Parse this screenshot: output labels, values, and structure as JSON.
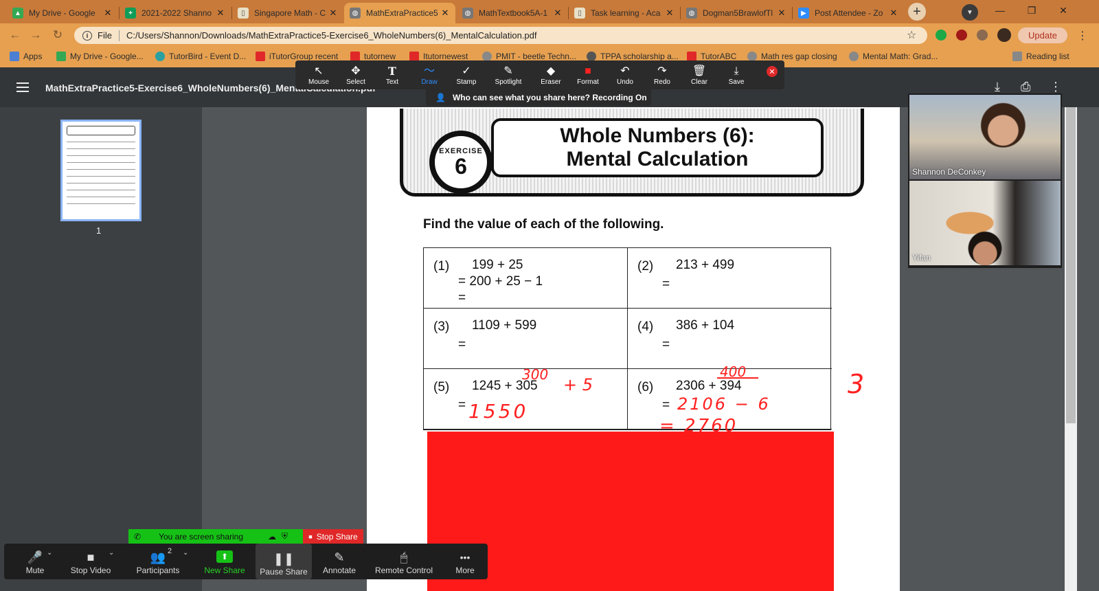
{
  "tabs": [
    {
      "title": "My Drive - Google",
      "icon": "google-drive-icon",
      "color": "#34a853",
      "active": false
    },
    {
      "title": "2021-2022 Shanno",
      "icon": "google-sheets-icon",
      "color": "#0f9d58",
      "active": false
    },
    {
      "title": "Singapore Math - C",
      "icon": "document-icon",
      "color": "#e8e0c8",
      "active": false
    },
    {
      "title": "MathExtraPractice5",
      "icon": "globe-icon",
      "color": "#777777",
      "active": true
    },
    {
      "title": "MathTextbook5A-1",
      "icon": "globe-icon",
      "color": "#777777",
      "active": false
    },
    {
      "title": "Task learning - Aca",
      "icon": "document-icon",
      "color": "#e8e0c8",
      "active": false
    },
    {
      "title": "Dogman5BrawlofTl",
      "icon": "globe-icon",
      "color": "#777777",
      "active": false
    },
    {
      "title": "Post Attendee - Zo",
      "icon": "zoom-icon",
      "color": "#2d8cff",
      "active": false
    }
  ],
  "address": {
    "scheme": "File",
    "url": "C:/Users/Shannon/Downloads/MathExtraPractice5-Exercise6_WholeNumbers(6)_MentalCalculation.pdf"
  },
  "update_label": "Update",
  "bookmarks": [
    {
      "label": "Apps",
      "color": "#4a7fd4"
    },
    {
      "label": "My Drive - Google...",
      "color": "#34a853"
    },
    {
      "label": "TutorBird - Event D...",
      "color": "#2aa0a0"
    },
    {
      "label": "iTutorGroup recent",
      "color": "#e02828"
    },
    {
      "label": "tutornew",
      "color": "#e02828"
    },
    {
      "label": "Itutornewest",
      "color": "#e02828"
    },
    {
      "label": "PMIT - beetle Techn...",
      "color": "#888888"
    },
    {
      "label": "TPPA scholarship a...",
      "color": "#555555"
    },
    {
      "label": "TutorABC",
      "color": "#e02828"
    },
    {
      "label": "Math res gap closing",
      "color": "#888888"
    },
    {
      "label": "Mental Math: Grad...",
      "color": "#888888"
    },
    {
      "label": "Reading list",
      "color": "#888888"
    }
  ],
  "pdf": {
    "title": "MathExtraPractice5-Exercise6_WholeNumbers(6)_MentalCalculation.pdf",
    "page_number": "1"
  },
  "annotation_tools": [
    {
      "label": "Mouse",
      "icon": "↖",
      "active": false
    },
    {
      "label": "Select",
      "icon": "✥",
      "active": false
    },
    {
      "label": "Text",
      "icon": "T",
      "active": false
    },
    {
      "label": "Draw",
      "icon": "〜",
      "active": true
    },
    {
      "label": "Stamp",
      "icon": "✓",
      "active": false
    },
    {
      "label": "Spotlight",
      "icon": "✎",
      "active": false
    },
    {
      "label": "Eraser",
      "icon": "◆",
      "active": false
    },
    {
      "label": "Format",
      "icon": "■",
      "active": false
    },
    {
      "label": "Undo",
      "icon": "↶",
      "active": false
    },
    {
      "label": "Redo",
      "icon": "↷",
      "active": false
    },
    {
      "label": "Clear",
      "icon": "🗑",
      "active": false
    },
    {
      "label": "Save",
      "icon": "⤓",
      "active": false
    }
  ],
  "share_notice": "Who can see what you share here? Recording On",
  "worksheet": {
    "badge_text": "EXERCISE",
    "badge_number": "6",
    "title_line1": "Whole Numbers (6):",
    "title_line2": "Mental Calculation",
    "instruction": "Find the value of each of the following.",
    "problems": [
      {
        "num": "(1)",
        "expr": "199 + 25",
        "line2": "= 200 + 25 − 1",
        "line3": "="
      },
      {
        "num": "(2)",
        "expr": "213 + 499",
        "line2": "=",
        "line3": ""
      },
      {
        "num": "(3)",
        "expr": "1109 + 599",
        "line2": "=",
        "line3": ""
      },
      {
        "num": "(4)",
        "expr": "386 + 104",
        "line2": "=",
        "line3": ""
      },
      {
        "num": "(5)",
        "expr": "1245 + 305",
        "line2": "=",
        "line3": ""
      },
      {
        "num": "(6)",
        "expr": "2306 + 394",
        "line2": "=",
        "line3": ""
      }
    ],
    "handwriting": {
      "p5_above": "300",
      "p5_side": "+ 5",
      "p5_answer": "1550",
      "p6_above": "400",
      "p6_step": "2106 − 6",
      "p6_answer": "= 2760",
      "margin_mark": "3"
    }
  },
  "participants": [
    {
      "name": "Shannon DeConkey"
    },
    {
      "name": "Yifan"
    }
  ],
  "zoom": {
    "sharing_text": "You are screen sharing",
    "stop_share": "Stop Share",
    "participant_count": "2",
    "buttons": [
      {
        "label": "Mute",
        "icon": "🎤"
      },
      {
        "label": "Stop Video",
        "icon": "■"
      },
      {
        "label": "Participants",
        "icon": "👥"
      },
      {
        "label": "New Share",
        "icon": "⬆"
      },
      {
        "label": "Pause Share",
        "icon": "❚❚"
      },
      {
        "label": "Annotate",
        "icon": "✎"
      },
      {
        "label": "Remote Control",
        "icon": "🖱"
      },
      {
        "label": "More",
        "icon": "•••"
      }
    ]
  }
}
